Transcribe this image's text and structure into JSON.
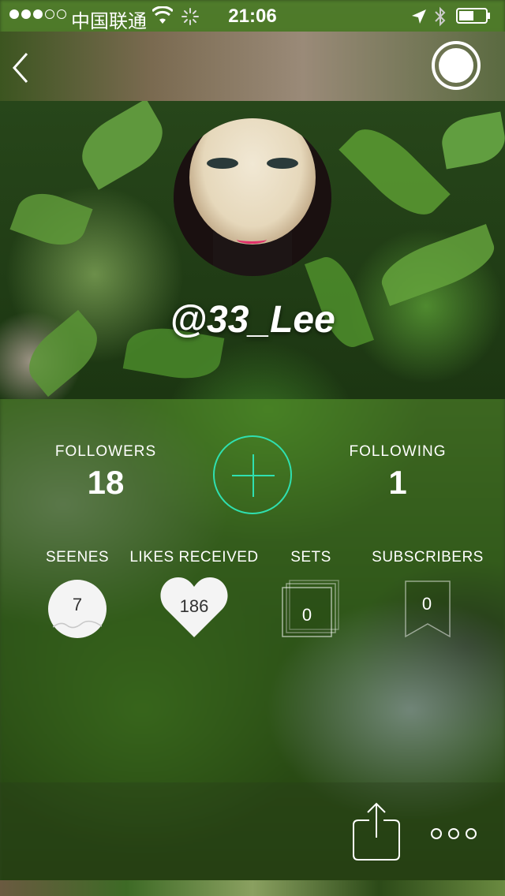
{
  "status_bar": {
    "carrier": "中国联通",
    "time": "21:06"
  },
  "profile": {
    "username": "@33_Lee"
  },
  "stats": {
    "followers_label": "FOLLOWERS",
    "followers_value": "18",
    "following_label": "FOLLOWING",
    "following_value": "1"
  },
  "categories": [
    {
      "label": "SEENES",
      "value": "7"
    },
    {
      "label": "LIKES RECEIVED",
      "value": "186"
    },
    {
      "label": "SETS",
      "value": "0"
    },
    {
      "label": "SUBSCRIBERS",
      "value": "0"
    }
  ],
  "icons": {
    "back": "chevron-left-icon",
    "record": "record-icon",
    "follow": "plus-icon",
    "share": "share-icon",
    "more": "more-dots-icon"
  },
  "colors": {
    "accent": "#2fe0b0"
  }
}
